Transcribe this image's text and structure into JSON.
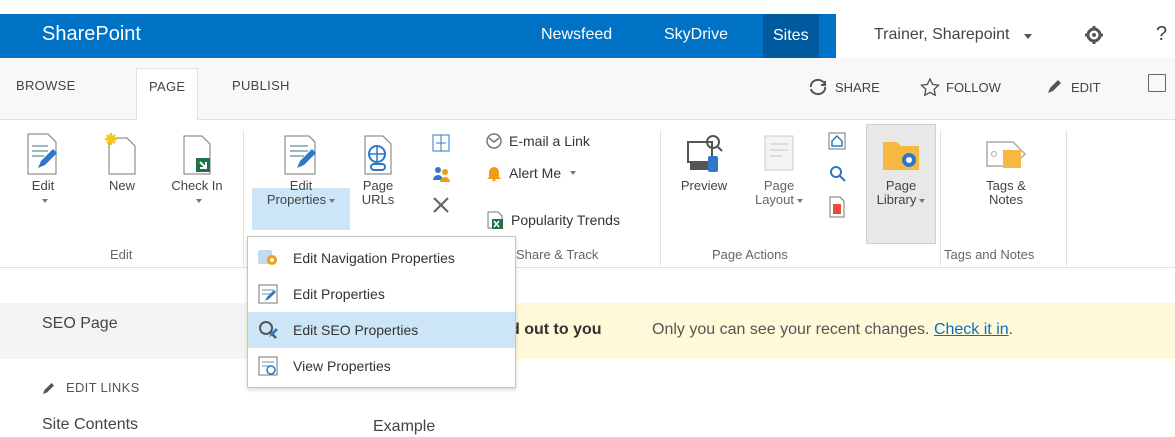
{
  "suitebar": {
    "brand": "SharePoint",
    "links": [
      "Newsfeed",
      "SkyDrive",
      "Sites"
    ],
    "user": "Trainer, Sharepoint",
    "help": "?"
  },
  "ribbon_tabs": {
    "tabs": [
      "BROWSE",
      "PAGE",
      "PUBLISH"
    ],
    "selected": "PAGE",
    "actions": [
      "SHARE",
      "FOLLOW",
      "EDIT"
    ]
  },
  "ribbon": {
    "edit_group": {
      "buttons": [
        "Edit",
        "New",
        "Check In"
      ],
      "label": "Edit"
    },
    "manage_group": {
      "edit_properties": [
        "Edit",
        "Properties"
      ],
      "page_urls": [
        "Page",
        "URLs"
      ]
    },
    "share_group": {
      "items": [
        "E-mail a Link",
        "Alert Me",
        "Popularity Trends"
      ],
      "label": "Share & Track"
    },
    "page_actions_group": {
      "preview": "Preview",
      "page_layout": [
        "Page",
        "Layout"
      ],
      "page_library": [
        "Page",
        "Library"
      ],
      "label": "Page Actions"
    },
    "tags_group": {
      "tags_notes": [
        "Tags &",
        "Notes"
      ],
      "label": "Tags and Notes"
    }
  },
  "dropdown": {
    "items": [
      "Edit Navigation Properties",
      "Edit Properties",
      "Edit SEO Properties",
      "View Properties"
    ],
    "hovered": "Edit SEO Properties"
  },
  "page": {
    "title": "SEO Page",
    "notice_bold": "d out to you",
    "notice_text": "Only you can see your recent changes.",
    "notice_link": "Check it in",
    "notice_end": ".",
    "edit_links": "EDIT LINKS",
    "site_contents": "Site Contents",
    "content": "Example"
  }
}
